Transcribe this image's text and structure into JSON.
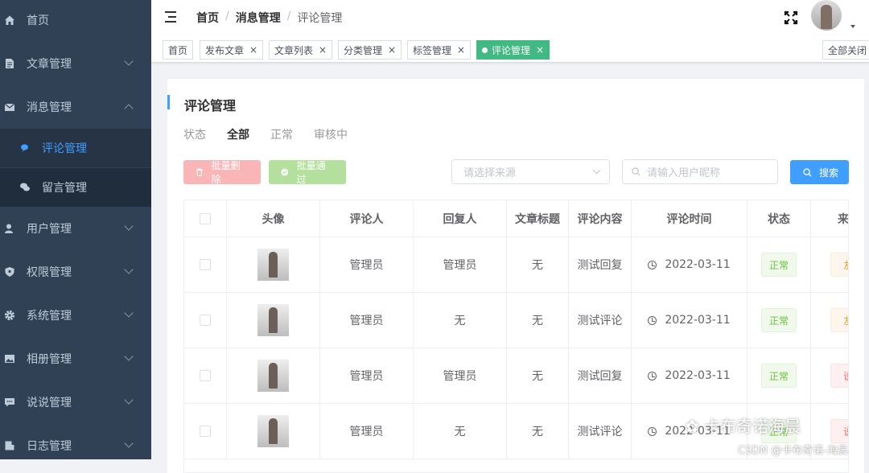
{
  "sidebar": {
    "items": [
      {
        "label": "首页"
      },
      {
        "label": "文章管理"
      },
      {
        "label": "消息管理"
      },
      {
        "label": "用户管理"
      },
      {
        "label": "权限管理"
      },
      {
        "label": "系统管理"
      },
      {
        "label": "相册管理"
      },
      {
        "label": "说说管理"
      },
      {
        "label": "日志管理"
      }
    ],
    "sub_items": [
      {
        "label": "评论管理"
      },
      {
        "label": "留言管理"
      }
    ]
  },
  "breadcrumb": {
    "items": [
      "首页",
      "消息管理",
      "评论管理"
    ],
    "separator": "/"
  },
  "tags": {
    "items": [
      "首页",
      "发布文章",
      "文章列表",
      "分类管理",
      "标签管理",
      "评论管理"
    ],
    "active": "评论管理",
    "close_all": "全部关闭",
    "close_glyph": "×"
  },
  "card": {
    "title": "评论管理",
    "status_label": "状态",
    "status_tabs": [
      "全部",
      "正常",
      "审核中"
    ],
    "active_status": "全部",
    "batch_delete": "批量删除",
    "batch_pass": "批量通过",
    "source_placeholder": "请选择来源",
    "search_placeholder": "请输入用户昵称",
    "search_button": "搜索"
  },
  "table": {
    "headers": [
      "头像",
      "评论人",
      "回复人",
      "文章标题",
      "评论内容",
      "评论时间",
      "状态",
      "来"
    ],
    "rows": [
      {
        "commenter": "管理员",
        "reply_to": "管理员",
        "article": "无",
        "content": "测试回复",
        "time": "2022-03-11",
        "status": "正常",
        "source": "友"
      },
      {
        "commenter": "管理员",
        "reply_to": "无",
        "article": "无",
        "content": "测试评论",
        "time": "2022-03-11",
        "status": "正常",
        "source": "友"
      },
      {
        "commenter": "管理员",
        "reply_to": "管理员",
        "article": "无",
        "content": "测试回复",
        "time": "2022-03-11",
        "status": "正常",
        "source": "说"
      },
      {
        "commenter": "管理员",
        "reply_to": "无",
        "article": "无",
        "content": "测试评论",
        "time": "2022-03-11",
        "status": "正常",
        "source": "说"
      }
    ]
  },
  "watermark": {
    "text": "卡布奇诺海晨",
    "csdn": "CSDN @卡布奇诺-海晨"
  },
  "colors": {
    "sidebar_bg": "#304156",
    "active_menu": "#409eff",
    "active_tag": "#42b983",
    "primary": "#409eff"
  }
}
